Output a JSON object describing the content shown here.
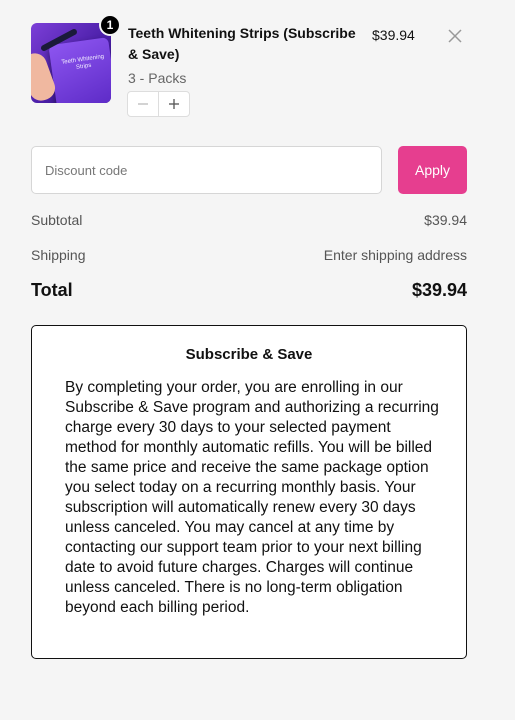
{
  "cart": {
    "item": {
      "quantity_badge": "1",
      "title": "Teeth Whitening Strips (Subscribe & Save)",
      "variant": "3 - Packs",
      "price": "$39.94",
      "image_text": "Teeth Whitening Strips",
      "stepper": {
        "minus_icon": "minus-icon",
        "plus_icon": "plus-icon"
      },
      "remove_icon": "close-icon"
    }
  },
  "discount": {
    "placeholder": "Discount code",
    "value": "",
    "apply_label": "Apply",
    "apply_color": "#e63e8f"
  },
  "summary": {
    "subtotal_label": "Subtotal",
    "subtotal_value": "$39.94",
    "shipping_label": "Shipping",
    "shipping_value": "Enter shipping address",
    "total_label": "Total",
    "total_value": "$39.94"
  },
  "subscription_notice": {
    "title": "Subscribe & Save",
    "body": "By completing your order, you are enrolling in our Subscribe & Save program and authorizing a recurring charge every 30 days to your selected payment method for monthly automatic refills. You will be billed the same price and receive the same package option you select today on a recurring monthly basis. Your subscription will automatically renew every 30 days unless canceled. You may cancel at any time by contacting our support team prior to your next billing date to avoid future charges. Charges will continue unless canceled. There is no long-term obligation beyond each billing period."
  }
}
